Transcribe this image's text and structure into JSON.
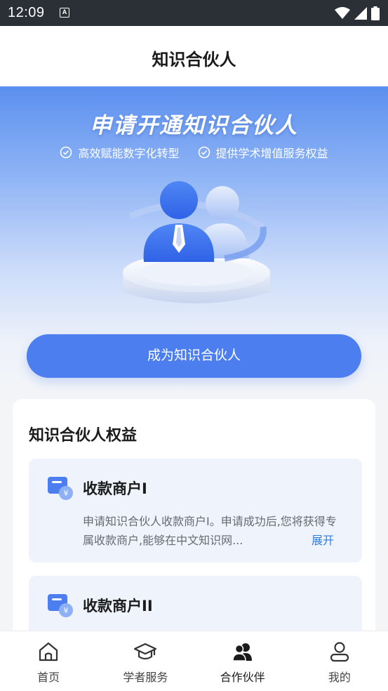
{
  "status": {
    "time": "12:09",
    "notification_glyph": "A"
  },
  "header": {
    "title": "知识合伙人"
  },
  "hero": {
    "title": "申请开通知识合伙人",
    "features": [
      "高效赋能数字化转型",
      "提供学术增值服务权益"
    ]
  },
  "cta": {
    "label": "成为知识合伙人"
  },
  "benefits": {
    "title": "知识合伙人权益",
    "items": [
      {
        "name": "收款商户I",
        "description": "申请知识合伙人收款商户I。申请成功后,您将获得专属收款商户,能够在中文知识网...",
        "expand": "展开"
      },
      {
        "name": "收款商户II"
      }
    ]
  },
  "tabs": [
    {
      "label": "首页",
      "icon": "home-icon"
    },
    {
      "label": "学者服务",
      "icon": "scholar-cap-icon"
    },
    {
      "label": "合作伙伴",
      "icon": "partners-icon",
      "active": true
    },
    {
      "label": "我的",
      "icon": "profile-icon"
    }
  ],
  "colors": {
    "primary": "#4c7ef0",
    "link": "#2f7de1",
    "status_bar": "#2b2f36"
  }
}
